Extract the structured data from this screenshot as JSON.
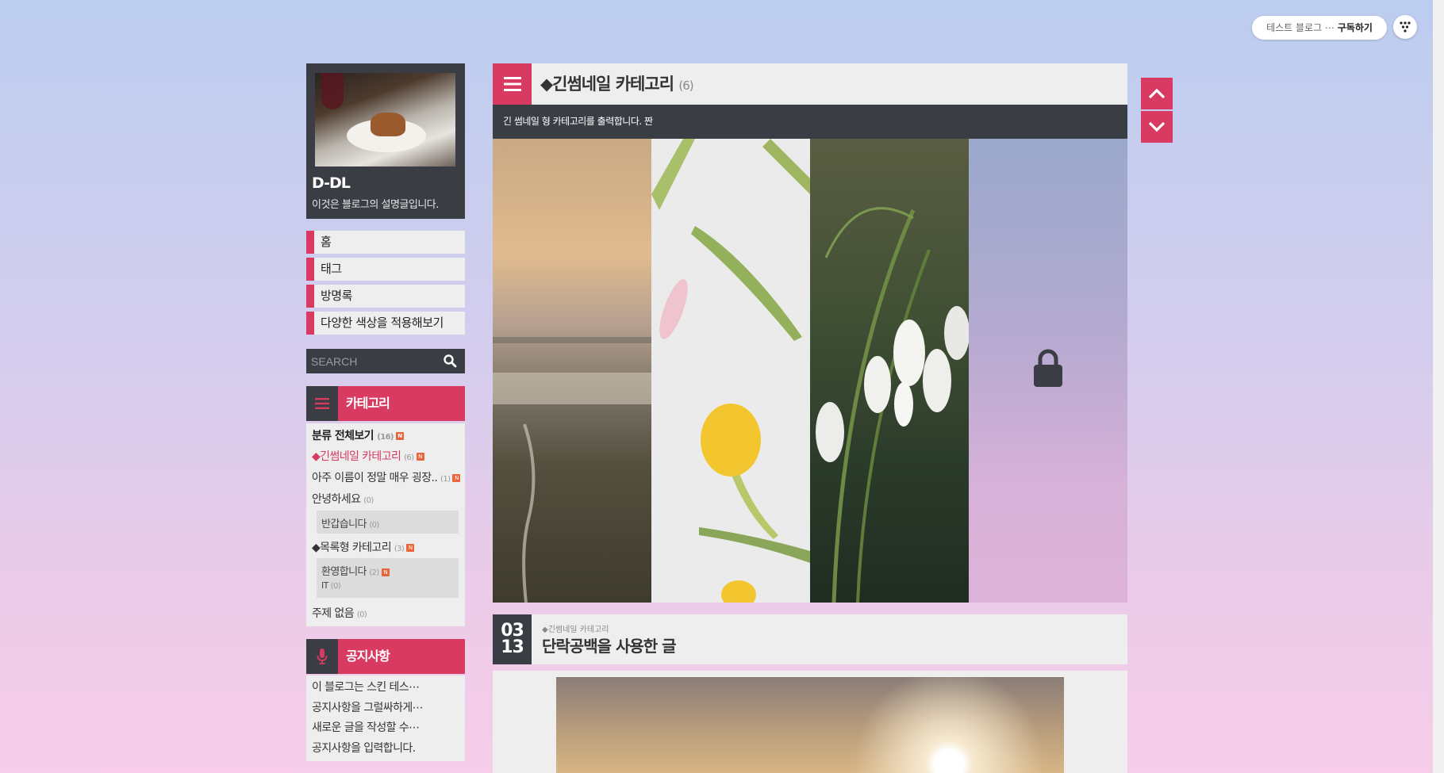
{
  "topbar": {
    "subscribe_blog": "테스트 블로그 ⋯",
    "subscribe_label": "구독하기"
  },
  "profile": {
    "title": "D-DL",
    "description": "이것은 블로그의 설명글입니다."
  },
  "nav": [
    "홈",
    "태그",
    "방명록",
    "다양한 색상을 적용해보기"
  ],
  "search": {
    "placeholder": "SEARCH"
  },
  "category": {
    "heading": "카테고리",
    "all": {
      "label": "분류 전체보기",
      "count": "(16)"
    },
    "items": [
      {
        "label": "◆긴썸네일 카테고리",
        "count": "(6)"
      },
      {
        "label": "아주 이름이 정말 매우 굉장..",
        "count": "(1)"
      },
      {
        "label": "안녕하세요",
        "count": "(0)"
      }
    ],
    "sub1": {
      "label": "반갑습니다",
      "count": "(0)"
    },
    "list_cat": {
      "label": "◆목록형 카테고리",
      "count": "(3)"
    },
    "sub2": [
      {
        "label": "환영합니다",
        "count": "(2)"
      },
      {
        "label": "IT",
        "count": "(0)"
      }
    ],
    "none": {
      "label": "주제 없음",
      "count": "(0)"
    },
    "new_badge": "N"
  },
  "notice": {
    "heading": "공지사항",
    "items": [
      "이 블로그는 스킨 테스⋯",
      "공지사항을 그럴싸하게⋯",
      "새로운 글을 작성할 수⋯",
      "공지사항을 입력합니다."
    ]
  },
  "main": {
    "category_title": "◆긴썸네일 카테고리",
    "category_count": "(6)",
    "category_desc": "긴 썸네일 형 카테고리를 출력합니다. 짠"
  },
  "post": {
    "month": "03",
    "day": "13",
    "category": "◆긴썸네일 카테고리",
    "title": "단락공백을 사용한 글"
  },
  "colors": {
    "accent": "#d83a62",
    "dark": "#3b3d45",
    "panel": "#eeeeee"
  }
}
